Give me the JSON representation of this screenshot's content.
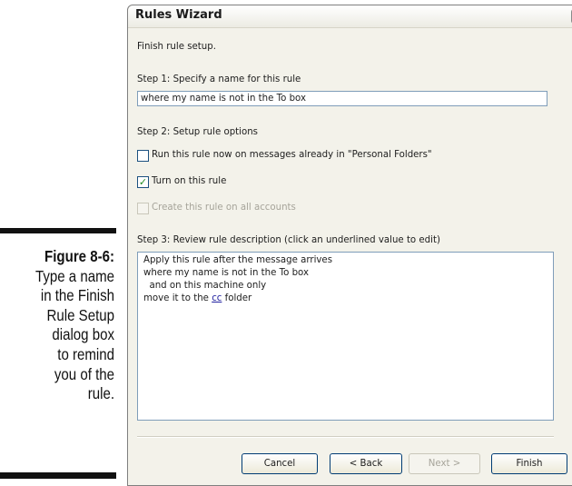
{
  "caption": {
    "figure": "Figure 8-6:",
    "lines": [
      "Type a name",
      "in the Finish",
      "Rule Setup",
      "dialog box",
      "to remind",
      "you of the",
      "rule."
    ]
  },
  "window": {
    "title": "Rules Wizard",
    "close_icon": "close-icon"
  },
  "intro": "Finish rule setup.",
  "step1": {
    "label": "Step 1: Specify a name for this rule",
    "value": "where my name is not in the To box"
  },
  "step2": {
    "label": "Step 2: Setup rule options",
    "options": [
      {
        "label": "Run this rule now on messages already in \"Personal Folders\"",
        "checked": false,
        "enabled": true
      },
      {
        "label": "Turn on this rule",
        "checked": true,
        "enabled": true
      },
      {
        "label": "Create this rule on all accounts",
        "checked": false,
        "enabled": false
      }
    ]
  },
  "step3": {
    "label": "Step 3: Review rule description (click an underlined value to edit)",
    "lines": [
      "Apply this rule after the message arrives",
      "where my name is not in the To box",
      "  and on this machine only"
    ],
    "action_prefix": "move it to the ",
    "action_link": "cc",
    "action_suffix": " folder"
  },
  "buttons": {
    "cancel": "Cancel",
    "back": "< Back",
    "next": "Next >",
    "finish": "Finish"
  }
}
